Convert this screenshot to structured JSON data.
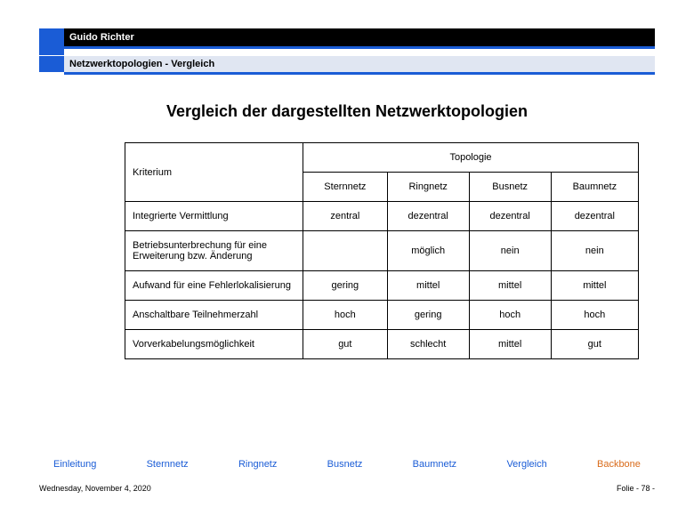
{
  "header": {
    "author": "Guido Richter",
    "breadcrumb": "Netzwerktopologien  - Vergleich"
  },
  "title": "Vergleich der dargestellten Netzwerktopologien",
  "chart_data": {
    "type": "table",
    "kriterium_label": "Kriterium",
    "topologie_label": "Topologie",
    "columns": [
      "Sternnetz",
      "Ringnetz",
      "Busnetz",
      "Baumnetz"
    ],
    "rows": [
      {
        "kriterium": "Integrierte Vermittlung",
        "values": [
          "zentral",
          "dezentral",
          "dezentral",
          "dezentral"
        ]
      },
      {
        "kriterium": "Betriebsunterbrechung für eine Erweiterung bzw. Änderung",
        "values": [
          "",
          "möglich",
          "nein",
          "nein"
        ]
      },
      {
        "kriterium": "Aufwand für eine Fehlerlokalisierung",
        "values": [
          "gering",
          "mittel",
          "mittel",
          "mittel"
        ]
      },
      {
        "kriterium": "Anschaltbare Teilnehmerzahl",
        "values": [
          "hoch",
          "gering",
          "hoch",
          "hoch"
        ]
      },
      {
        "kriterium": "Vorverkabelungsmöglichkeit",
        "values": [
          "gut",
          "schlecht",
          "mittel",
          "gut"
        ]
      }
    ]
  },
  "nav": {
    "items": [
      "Einleitung",
      "Sternnetz",
      "Ringnetz",
      "Busnetz",
      "Baumnetz",
      "Vergleich",
      "Backbone"
    ]
  },
  "footer": {
    "date": "Wednesday, November 4, 2020",
    "page": "Folie - 78 -"
  }
}
